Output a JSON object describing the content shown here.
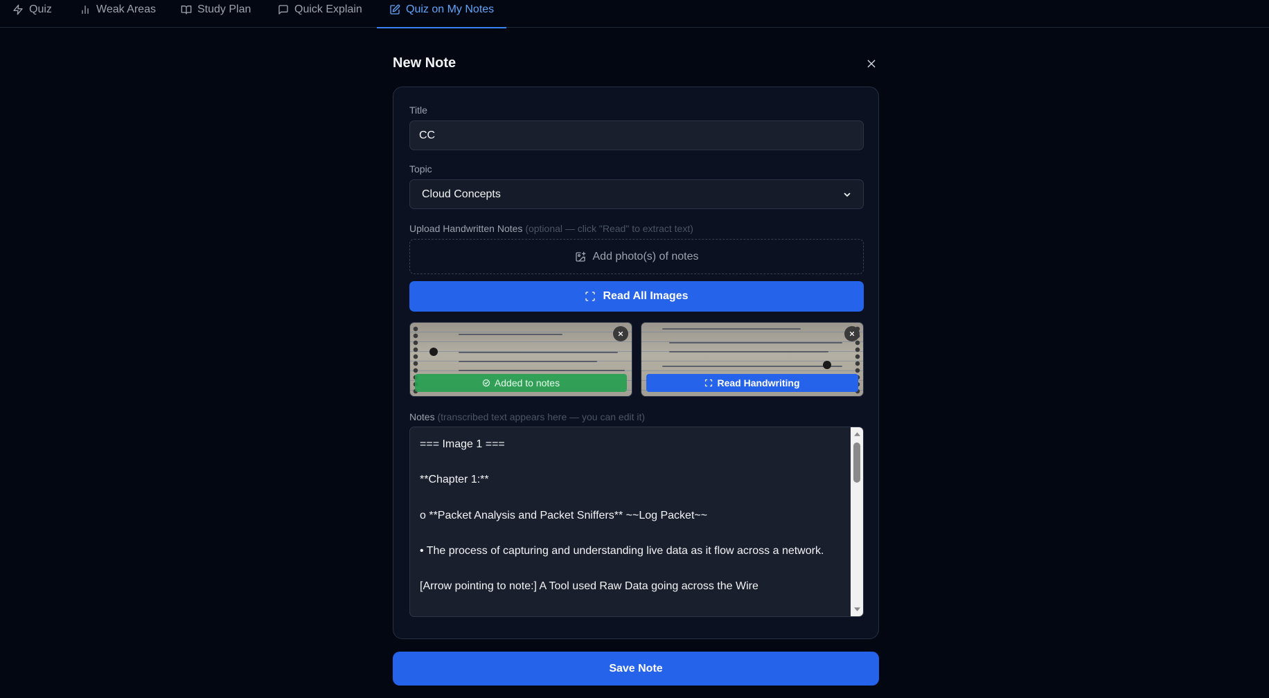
{
  "nav": {
    "tabs": [
      {
        "label": "Quiz",
        "icon": "zap-icon"
      },
      {
        "label": "Weak Areas",
        "icon": "bar-chart-icon"
      },
      {
        "label": "Study Plan",
        "icon": "book-open-icon"
      },
      {
        "label": "Quick Explain",
        "icon": "message-square-icon"
      },
      {
        "label": "Quiz on My Notes",
        "icon": "edit-note-icon",
        "active": true
      }
    ]
  },
  "modal": {
    "title": "New Note",
    "close_icon": "close-icon"
  },
  "form": {
    "title_label": "Title",
    "title_value": "CC",
    "topic_label": "Topic",
    "topic_value": "Cloud Concepts",
    "upload_label": "Upload Handwritten Notes",
    "upload_hint": "(optional — click \"Read\" to extract text)",
    "upload_button": "Add photo(s) of notes",
    "read_all_button": "Read All Images",
    "images": [
      {
        "status_label": "Added to notes",
        "status": "added"
      },
      {
        "status_label": "Read Handwriting",
        "status": "pending"
      }
    ],
    "notes_label": "Notes",
    "notes_hint": "(transcribed text appears here — you can edit it)",
    "notes_lines": [
      "=== Image 1 ===",
      "**Chapter 1:**",
      "o **Packet Analysis and Packet Sniffers** ~~Log Packet~~",
      "• The process of capturing and understanding live data as it flow across a network.",
      "[Arrow pointing to note:] A Tool used Raw Data going across the Wire"
    ]
  },
  "footer": {
    "save_button": "Save Note"
  },
  "colors": {
    "background": "#030712",
    "accent": "#2563eb",
    "active_tab": "#60a5fa",
    "success": "#27a050"
  }
}
